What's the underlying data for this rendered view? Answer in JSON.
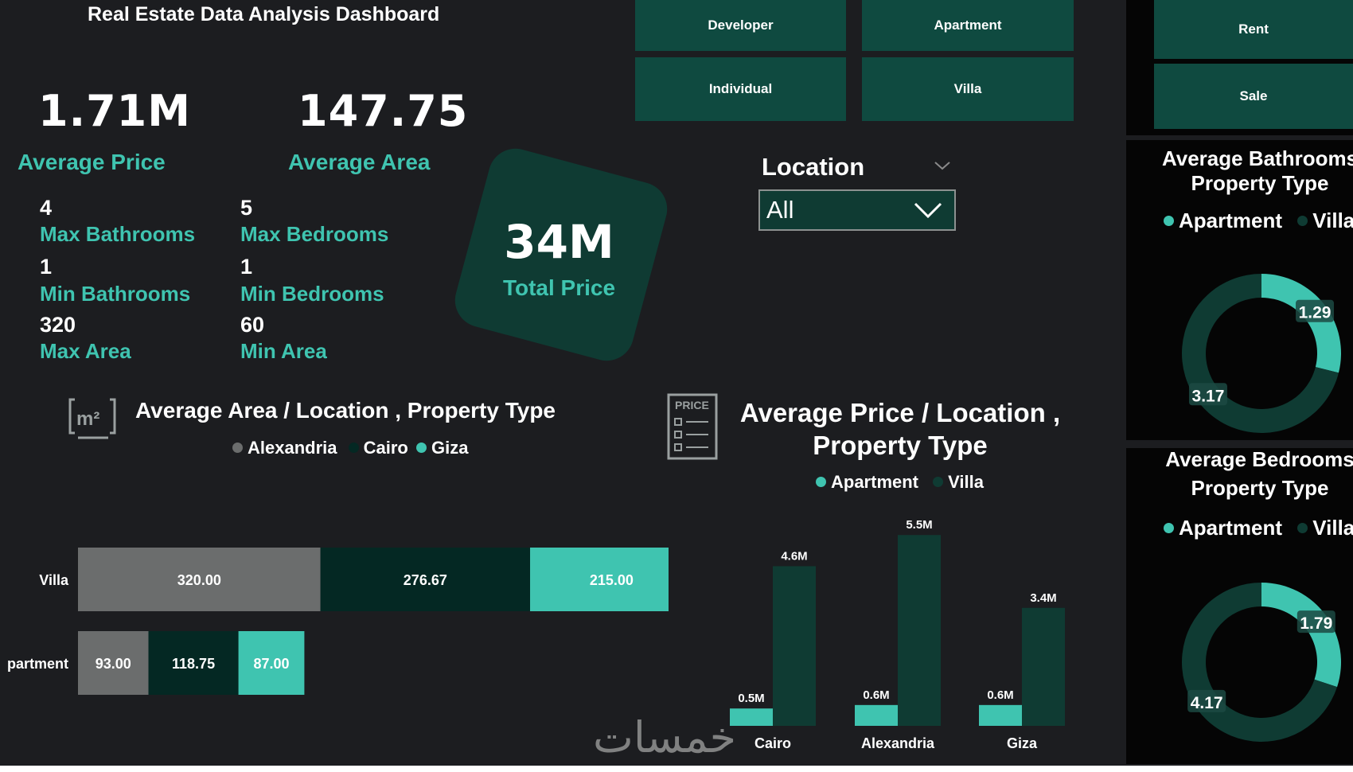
{
  "header": {
    "title": "Real Estate Data Analysis Dashboard"
  },
  "kpis": {
    "avg_price": {
      "value": "1.71M",
      "label": "Average Price"
    },
    "avg_area": {
      "value": "147.75",
      "label": "Average Area"
    },
    "total_price": {
      "value": "34M",
      "label": "Total Price"
    }
  },
  "stats": {
    "max_bathrooms": {
      "value": "4",
      "label": "Max Bathrooms"
    },
    "max_bedrooms": {
      "value": "5",
      "label": "Max Bedrooms"
    },
    "min_bathrooms": {
      "value": "1",
      "label": "Min Bathrooms"
    },
    "min_bedrooms": {
      "value": "1",
      "label": "Min Bedrooms"
    },
    "max_area": {
      "value": "320",
      "label": "Max Area"
    },
    "min_area": {
      "value": "60",
      "label": "Min Area"
    }
  },
  "slicers": {
    "seller": [
      "Developer",
      "Individual"
    ],
    "property": [
      "Apartment",
      "Villa"
    ],
    "listing": [
      "Rent",
      "Sale"
    ]
  },
  "location_filter": {
    "label": "Location",
    "selected": "All"
  },
  "icons": {
    "area": "area-m2-icon",
    "price": "price-tag-icon"
  },
  "colors": {
    "teal": "#3fc4b0",
    "dark_green": "#0f3b33",
    "gray": "#6b6d6d",
    "cairo": "#042823"
  },
  "watermark": "خمسات",
  "chart_data": [
    {
      "id": "avg_area",
      "type": "bar",
      "orientation": "horizontal",
      "stacked": true,
      "title": "Average Area / Location , Property Type",
      "categories": [
        "Villa",
        "Apartment"
      ],
      "category_labels": [
        "Villa",
        "partment"
      ],
      "series": [
        {
          "name": "Alexandria",
          "values": [
            320.0,
            93.0
          ],
          "labels": [
            "320.00",
            "93.00"
          ]
        },
        {
          "name": "Cairo",
          "values": [
            276.67,
            118.75
          ],
          "labels": [
            "276.67",
            "118.75"
          ]
        },
        {
          "name": "Giza",
          "values": [
            215.0,
            87.0
          ],
          "labels": [
            "215.00",
            "87.00"
          ]
        }
      ]
    },
    {
      "id": "avg_price",
      "type": "bar",
      "title_line1": "Average Price / Location ,",
      "title_line2": "Property Type",
      "categories": [
        "Cairo",
        "Alexandria",
        "Giza"
      ],
      "series": [
        {
          "name": "Apartment",
          "values": [
            0.5,
            0.6,
            0.6
          ],
          "labels": [
            "0.5M",
            "0.6M",
            "0.6M"
          ]
        },
        {
          "name": "Villa",
          "values": [
            4.6,
            5.5,
            3.4
          ],
          "labels": [
            "4.6M",
            "5.5M",
            "3.4M"
          ]
        }
      ]
    },
    {
      "id": "avg_bathrooms",
      "type": "pie",
      "donut": true,
      "title_line1": "Average Bathrooms",
      "title_line2": "Property Type",
      "categories": [
        "Apartment",
        "Villa"
      ],
      "values": [
        1.29,
        3.17
      ],
      "labels": [
        "1.29",
        "3.17"
      ]
    },
    {
      "id": "avg_bedrooms",
      "type": "pie",
      "donut": true,
      "title_line1": "Average Bedrooms",
      "title_line2": "Property Type",
      "categories": [
        "Apartment",
        "Villa"
      ],
      "values": [
        1.79,
        4.17
      ],
      "labels": [
        "1.79",
        "4.17"
      ]
    }
  ]
}
